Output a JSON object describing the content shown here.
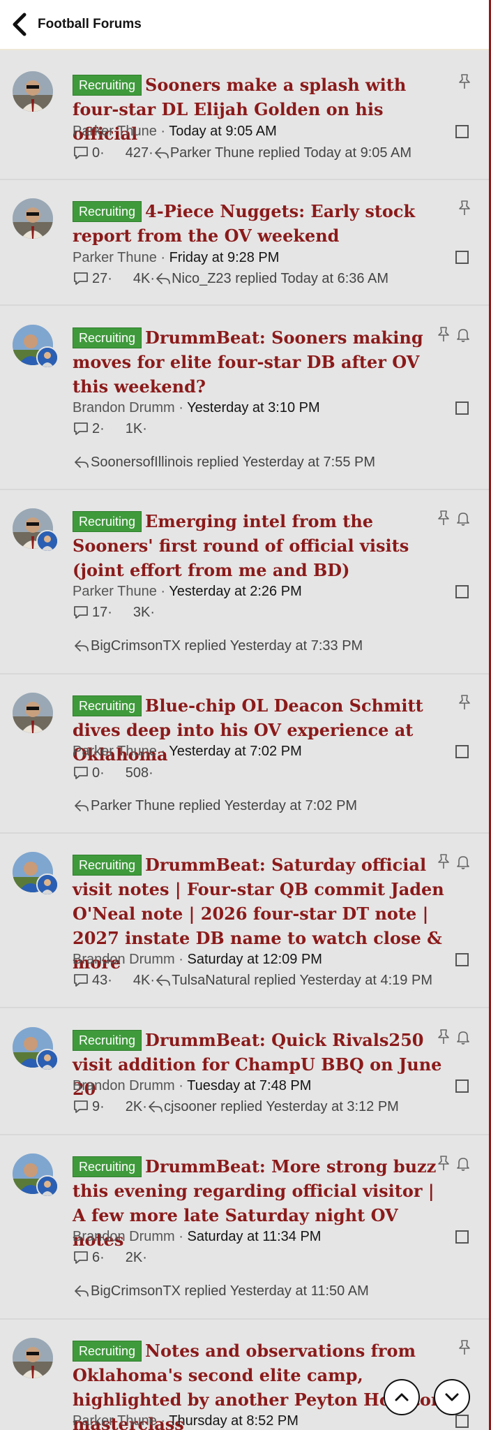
{
  "header": {
    "title": "Football Forums"
  },
  "threads": [
    {
      "label": "Recruiting",
      "title": "Sooners make a splash with four-star DL Elijah Golden on his official",
      "author": "Parker Thune",
      "date": "Today at 9:05 AM",
      "replies": "0",
      "views": "427",
      "last_reply": "Parker Thune replied Today at 9:05 AM",
      "avatar": "parker"
    },
    {
      "label": "Recruiting",
      "title": "4-Piece Nuggets: Early stock report from the OV weekend",
      "author": "Parker Thune",
      "date": "Friday at 9:28 PM",
      "replies": "27",
      "views": "4K",
      "last_reply": "Nico_Z23 replied Today at 6:36 AM",
      "avatar": "parker"
    },
    {
      "label": "Recruiting",
      "title": "DrummBeat: Sooners making moves for elite four-star DB after OV this weekend?",
      "author": "Brandon Drumm",
      "date": "Yesterday at 3:10 PM",
      "replies": "2",
      "views": "1K",
      "last_reply": "SoonersofIllinois replied Yesterday at 7:55 PM",
      "avatar": "brandon"
    },
    {
      "label": "Recruiting",
      "title": "Emerging intel from the Sooners' first round of official visits (joint effort from me and BD)",
      "author": "Parker Thune",
      "date": "Yesterday at 2:26 PM",
      "replies": "17",
      "views": "3K",
      "last_reply": "BigCrimsonTX replied Yesterday at 7:33 PM",
      "avatar": "parker"
    },
    {
      "label": "Recruiting",
      "title": "Blue-chip OL Deacon Schmitt dives deep into his OV experience at Oklahoma",
      "author": "Parker Thune",
      "date": "Yesterday at 7:02 PM",
      "replies": "0",
      "views": "508",
      "last_reply": "Parker Thune replied Yesterday at 7:02 PM",
      "avatar": "parker"
    },
    {
      "label": "Recruiting",
      "title": "DrummBeat: Saturday official visit notes | Four-star QB commit Jaden O'Neal note | 2026 four-star DT note | 2027 instate DB name to watch close & more",
      "author": "Brandon Drumm",
      "date": "Saturday at 12:09 PM",
      "replies": "43",
      "views": "4K",
      "last_reply": "TulsaNatural replied Yesterday at 4:19 PM",
      "avatar": "brandon"
    },
    {
      "label": "Recruiting",
      "title": "DrummBeat: Quick Rivals250 visit addition for ChampU BBQ on June 20",
      "author": "Brandon Drumm",
      "date": "Tuesday at 7:48 PM",
      "replies": "9",
      "views": "2K",
      "last_reply": "cjsooner replied Yesterday at 3:12 PM",
      "avatar": "brandon"
    },
    {
      "label": "Recruiting",
      "title": "DrummBeat: More strong buzz this evening regarding official visitor | A few more late Saturday night OV notes",
      "author": "Brandon Drumm",
      "date": "Saturday at 11:34 PM",
      "replies": "6",
      "views": "2K",
      "last_reply": "BigCrimsonTX replied Yesterday at 11:50 AM",
      "avatar": "brandon"
    },
    {
      "label": "Recruiting",
      "title": "Notes and observations from Oklahoma's second elite camp, highlighted by another Peyton Houston masterclass",
      "author": "Parker Thune",
      "date": "Thursday at 8:52 PM",
      "replies": "",
      "views": "",
      "last_reply": "",
      "avatar": "parker"
    }
  ],
  "colors": {
    "title": "#8b1a1a",
    "label_bg": "#3f9a3c",
    "page_bg": "#e5e5e5",
    "header_bg": "#ffffff"
  }
}
